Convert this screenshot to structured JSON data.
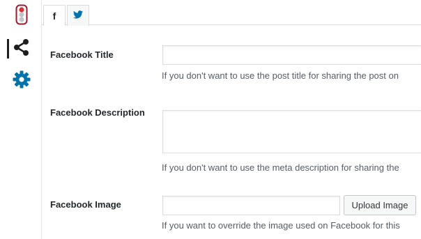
{
  "sidebar": {
    "items": [
      {
        "icon": "traffic-light-icon"
      },
      {
        "icon": "share-icon"
      },
      {
        "icon": "gear-icon"
      }
    ]
  },
  "tabs": [
    {
      "icon": "facebook-icon",
      "label": "f"
    },
    {
      "icon": "twitter-icon"
    }
  ],
  "form": {
    "title": {
      "label": "Facebook Title",
      "value": "",
      "help": "If you don't want to use the post title for sharing the post on"
    },
    "description": {
      "label": "Facebook Description",
      "value": "",
      "help": "If you don't want to use the meta description for sharing the"
    },
    "image": {
      "label": "Facebook Image",
      "value": "",
      "button_label": "Upload Image",
      "help": "If you want to override the image used on Facebook for this"
    }
  },
  "colors": {
    "accent": "#0073aa",
    "text": "#555d66",
    "label": "#23282d",
    "border": "#dcdcde"
  }
}
